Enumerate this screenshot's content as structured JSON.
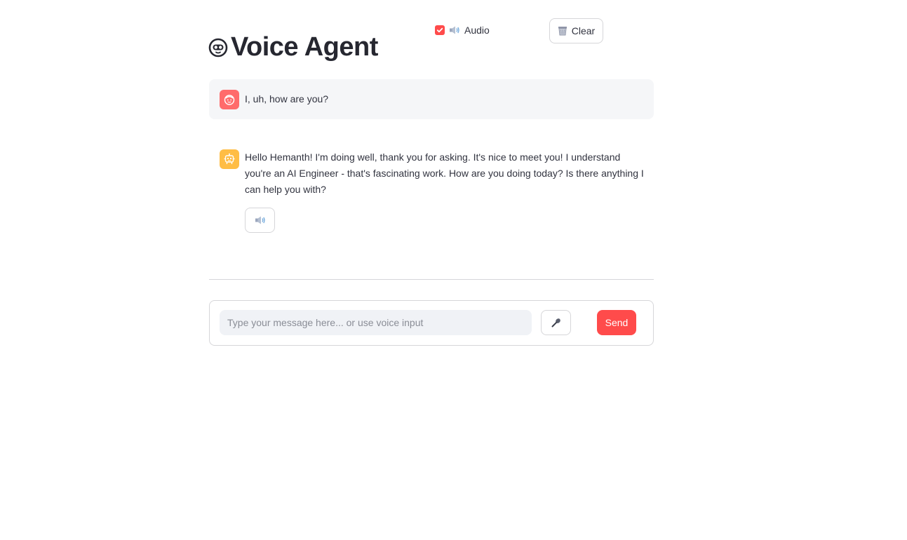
{
  "header": {
    "title": "Voice Agent",
    "title_icon": "robot-face-icon",
    "audio_toggle": {
      "label": "Audio",
      "checked": true,
      "icon": "speaker-icon"
    },
    "clear_button": {
      "label": "Clear",
      "icon": "wastebasket-icon"
    }
  },
  "messages": [
    {
      "role": "user",
      "avatar_icon": "user-face-icon",
      "text": "I, uh, how are you?"
    },
    {
      "role": "assistant",
      "avatar_icon": "robot-icon",
      "text": "Hello Hemanth! I'm doing well, thank you for asking. It's nice to meet you! I understand you're an AI Engineer - that's fascinating work. How are you doing today? Is there anything I can help you with?",
      "play_button_icon": "speaker-icon"
    }
  ],
  "input_form": {
    "placeholder": "Type your message here... or use voice input",
    "value": "",
    "mic_icon": "microphone-icon",
    "send_label": "Send"
  },
  "colors": {
    "accent": "#ff4b4b",
    "user_avatar": "#ff6b6b",
    "assistant_avatar": "#ffbd45",
    "user_message_bg": "#f5f6f8",
    "input_bg": "#f0f2f6",
    "text": "#31333f"
  }
}
